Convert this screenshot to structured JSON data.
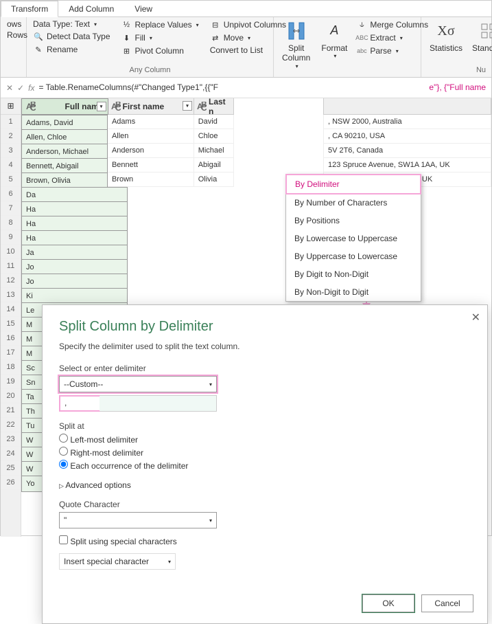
{
  "tabs": {
    "transform": "Transform",
    "addColumn": "Add Column",
    "view": "View"
  },
  "ribbon": {
    "left": {
      "rows": "Rows",
      "l2": "ows"
    },
    "table": {
      "dataType": "Data Type: Text",
      "detect": "Detect Data Type",
      "rename": "Rename"
    },
    "anyCol": {
      "replace": "Replace Values",
      "fill": "Fill",
      "pivot": "Pivot Column",
      "unpivot": "Unpivot Columns",
      "move": "Move",
      "convert": "Convert to List",
      "label": "Any Column"
    },
    "text": {
      "split": "Split\nColumn",
      "format": "Format",
      "merge": "Merge Columns",
      "extract": "Extract",
      "parse": "Parse"
    },
    "num": {
      "stats": "Statistics",
      "standard": "Standard",
      "nu": "Nu"
    }
  },
  "formula": {
    "fx": "fx",
    "pre": "= Table.RenameColumns(#\"Changed Type1\",{{\"F",
    "mid": "e\"}, {\"Full name"
  },
  "columns": {
    "fullName": "Full name",
    "firstName": "First name",
    "lastName": "Last n"
  },
  "rows": [
    {
      "n": "1",
      "full": "Adams, David",
      "first": "Adams",
      "last": "David",
      "addr": ", NSW 2000, Australia"
    },
    {
      "n": "2",
      "full": "Allen, Chloe",
      "first": "Allen",
      "last": "Chloe",
      "addr": ", CA 90210, USA"
    },
    {
      "n": "3",
      "full": "Anderson, Michael",
      "first": "Anderson",
      "last": "Michael",
      "addr": "5V 2T6, Canada"
    },
    {
      "n": "4",
      "full": "Bennett, Abigail",
      "first": "Bennett",
      "last": "Abigail",
      "addr": "123 Spruce Avenue, SW1A 1AA, UK"
    },
    {
      "n": "5",
      "full": "Brown, Olivia",
      "first": "Brown",
      "last": "Olivia",
      "addr": "789 Oak Drive, SW1A 1AA, UK"
    },
    {
      "n": "6",
      "full": "Da",
      "first": "",
      "last": "",
      "addr": ""
    },
    {
      "n": "7",
      "full": "Ha",
      "first": "",
      "last": "",
      "addr": ""
    },
    {
      "n": "8",
      "full": "Ha",
      "first": "",
      "last": "",
      "addr": ""
    },
    {
      "n": "9",
      "full": "Ha",
      "first": "",
      "last": "",
      "addr": ""
    },
    {
      "n": "10",
      "full": "Ja",
      "first": "",
      "last": "",
      "addr": ""
    },
    {
      "n": "11",
      "full": "Jo",
      "first": "",
      "last": "",
      "addr": ""
    },
    {
      "n": "12",
      "full": "Jo",
      "first": "",
      "last": "",
      "addr": ""
    },
    {
      "n": "13",
      "full": "Ki",
      "first": "",
      "last": "",
      "addr": ""
    },
    {
      "n": "14",
      "full": "Le",
      "first": "",
      "last": "",
      "addr": ""
    },
    {
      "n": "15",
      "full": "M",
      "first": "",
      "last": "",
      "addr": ""
    },
    {
      "n": "16",
      "full": "M",
      "first": "",
      "last": "",
      "addr": ""
    },
    {
      "n": "17",
      "full": "M",
      "first": "",
      "last": "",
      "addr": ""
    },
    {
      "n": "18",
      "full": "Sc",
      "first": "",
      "last": "",
      "addr": ""
    },
    {
      "n": "19",
      "full": "Sn",
      "first": "",
      "last": "",
      "addr": ""
    },
    {
      "n": "20",
      "full": "Ta",
      "first": "",
      "last": "",
      "addr": ""
    },
    {
      "n": "21",
      "full": "Th",
      "first": "",
      "last": "",
      "addr": ""
    },
    {
      "n": "22",
      "full": "Tu",
      "first": "",
      "last": "",
      "addr": ""
    },
    {
      "n": "23",
      "full": "W",
      "first": "",
      "last": "",
      "addr": ""
    },
    {
      "n": "24",
      "full": "W",
      "first": "",
      "last": "",
      "addr": ""
    },
    {
      "n": "25",
      "full": "W",
      "first": "",
      "last": "",
      "addr": ""
    },
    {
      "n": "26",
      "full": "Yo",
      "first": "",
      "last": "",
      "addr": ""
    }
  ],
  "splitMenu": {
    "byDelim": "By Delimiter",
    "byNum": "By Number of Characters",
    "byPos": "By Positions",
    "byLU": "By Lowercase to Uppercase",
    "byUL": "By Uppercase to Lowercase",
    "byDN": "By Digit to Non-Digit",
    "byND": "By Non-Digit to Digit"
  },
  "dialog": {
    "title": "Split Column by Delimiter",
    "sub": "Specify the delimiter used to split the text column.",
    "selLabel": "Select or enter delimiter",
    "selVal": "--Custom--",
    "inputVal": ", ",
    "splitAt": "Split at",
    "r1": "Left-most delimiter",
    "r2": "Right-most delimiter",
    "r3": "Each occurrence of the delimiter",
    "adv": "Advanced options",
    "quote": "Quote Character",
    "quoteVal": "\"",
    "chk": "Split using special characters",
    "insert": "Insert special character",
    "ok": "OK",
    "cancel": "Cancel"
  }
}
